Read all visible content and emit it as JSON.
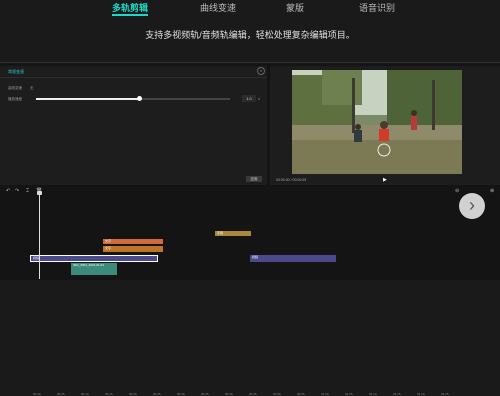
{
  "tabs": [
    {
      "label": "多轨剪辑",
      "active": true
    },
    {
      "label": "曲线变速",
      "active": false
    },
    {
      "label": "蒙版",
      "active": false
    },
    {
      "label": "语音识别",
      "active": false
    }
  ],
  "subtitle": "支持多视频轨/音频轨编辑，轻松处理复杂编辑项目。",
  "editor": {
    "panel_title": "常规变速",
    "prop_1": "曲线变速",
    "prop_1_value": "无",
    "prop_2": "播放速度",
    "speed_value": "1.0",
    "speed_unit": "x",
    "speed_fraction": 0.3,
    "apply_label": "应用",
    "close_icon": "close-icon",
    "time_readout": "00:00:00 / 00:00:09",
    "play_icon": "play-icon"
  },
  "toolbar": {
    "undo_icon": "undo-icon",
    "redo_icon": "redo-icon",
    "split_icon": "split-icon",
    "delete_icon": "delete-icon",
    "zoom_icon": "zoom-icon"
  },
  "ruler_ticks": [
    "00:00",
    "00:05",
    "00:10",
    "00:15",
    "00:20",
    "00:25",
    "00:30",
    "00:35",
    "00:40",
    "00:45",
    "00:50",
    "00:55",
    "01:00",
    "01:05",
    "01:10",
    "01:15",
    "01:20",
    "01:25",
    "01:30"
  ],
  "clips": {
    "title_clip": "字幕",
    "text_clip_1": "文字",
    "text_clip_2": "文字",
    "video_clip_1": "视频",
    "video_clip_2": "视频",
    "audio_clip": "IMG_0001_2021-01-01"
  },
  "colors": {
    "accent": "#1fd6c8",
    "clip_orange": "#d06a3c",
    "clip_gold": "#a88a3a",
    "clip_purple": "#4b4a8c",
    "clip_teal": "#3d8a7a"
  },
  "next_icon": "chevron-right-icon"
}
